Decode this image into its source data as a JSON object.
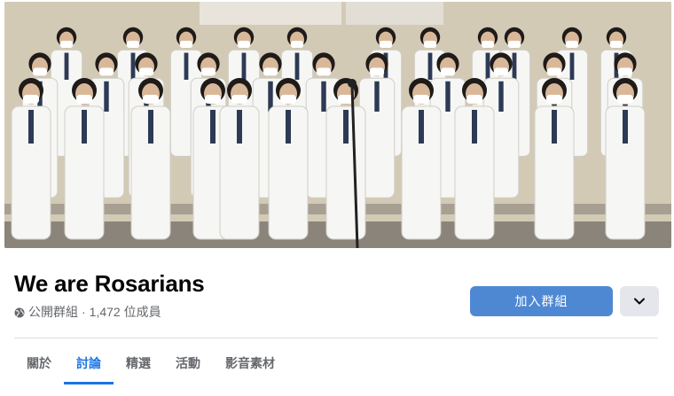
{
  "group": {
    "name": "We are Rosarians",
    "privacy": "公開群組",
    "separator": "·",
    "members": "1,472 位成員"
  },
  "actions": {
    "join_label": "加入群組"
  },
  "tabs": [
    {
      "label": "關於",
      "active": false
    },
    {
      "label": "討論",
      "active": true
    },
    {
      "label": "精選",
      "active": false
    },
    {
      "label": "活動",
      "active": false
    },
    {
      "label": "影音素材",
      "active": false
    }
  ],
  "colors": {
    "accent": "#1b74e4",
    "join_button": "#4e88d3",
    "muted_text": "#65676b"
  },
  "icons": {
    "privacy": "globe-icon",
    "more": "chevron-down-icon"
  }
}
